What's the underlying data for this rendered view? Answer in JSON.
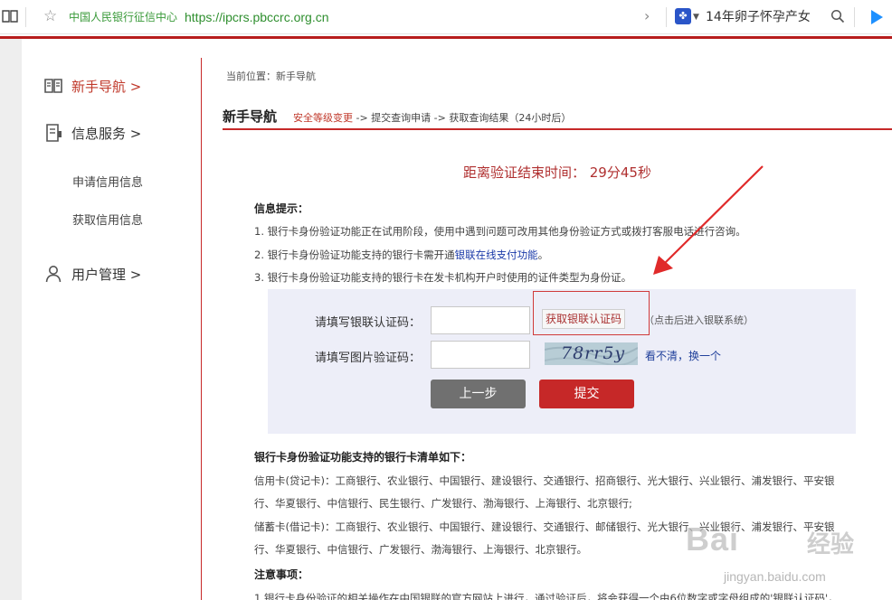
{
  "browser": {
    "site_name": "中国人民银行征信中心",
    "url": "https://ipcrs.pbccrc.org.cn",
    "search_text": "14年卵子怀孕产女"
  },
  "sidebar": {
    "items": [
      {
        "label": "新手导航 >",
        "icon": "book-icon",
        "active": true
      },
      {
        "label": "信息服务 >",
        "icon": "document-icon",
        "active": false
      },
      {
        "label": "用户管理 >",
        "icon": "user-icon",
        "active": false
      }
    ],
    "sub_items": [
      "申请信用信息",
      "获取信用信息"
    ]
  },
  "main": {
    "breadcrumb": "当前位置：新手导航",
    "title": "新手导航",
    "steps": {
      "current": "安全等级变更",
      "rest": " -> 提交查询申请 -> 获取查询结果（24小时后）"
    },
    "countdown": "距离验证结束时间：  29分45秒",
    "info_head": "信息提示：",
    "info_lines": [
      "1. 银行卡身份验证功能正在试用阶段，使用中遇到问题可改用其他身份验证方式或拨打客服电话进行咨询。",
      "2. 银行卡身份验证功能支持的银行卡需开通",
      "3. 银行卡身份验证功能支持的银行卡在发卡机构开户时使用的证件类型为身份证。"
    ],
    "info_link": "银联在线支付功能",
    "info_link_tail": "。"
  },
  "form": {
    "unionpay_code_label": "请填写银联认证码：",
    "unionpay_code_value": "",
    "get_code_button": "获取银联认证码",
    "get_code_hint": "（点击后进入银联系统）",
    "captcha_label": "请填写图片验证码：",
    "captcha_value": "",
    "captcha_image_text": "78rr5y",
    "refresh_link": "看不清，换一个",
    "back_button": "上一步",
    "submit_button": "提交"
  },
  "banks": {
    "head": "银行卡身份验证功能支持的银行卡清单如下：",
    "lines": [
      "信用卡(贷记卡)：工商银行、农业银行、中国银行、建设银行、交通银行、招商银行、光大银行、兴业银行、浦发银行、平安银",
      "行、华夏银行、中信银行、民生银行、广发银行、渤海银行、上海银行、北京银行;",
      "储蓄卡(借记卡)：工商银行、农业银行、中国银行、建设银行、交通银行、邮储银行、光大银行、兴业银行、浦发银行、平安银",
      "行、华夏银行、中信银行、广发银行、渤海银行、上海银行、北京银行。"
    ]
  },
  "notes": {
    "head": "注意事项：",
    "line": "1.银行卡身份验证的相关操作在中国银联的官方网站上进行，通过验证后，将会获得一个由6位数字或字母组成的'银联认证码'，"
  },
  "watermark": {
    "logo": "Bai",
    "logo_cn": "经验",
    "sub": "jingyan.baidu.com"
  },
  "colors": {
    "accent_red": "#c62828",
    "link_blue": "#1a3aa8",
    "panel_bg": "#edeef8"
  }
}
